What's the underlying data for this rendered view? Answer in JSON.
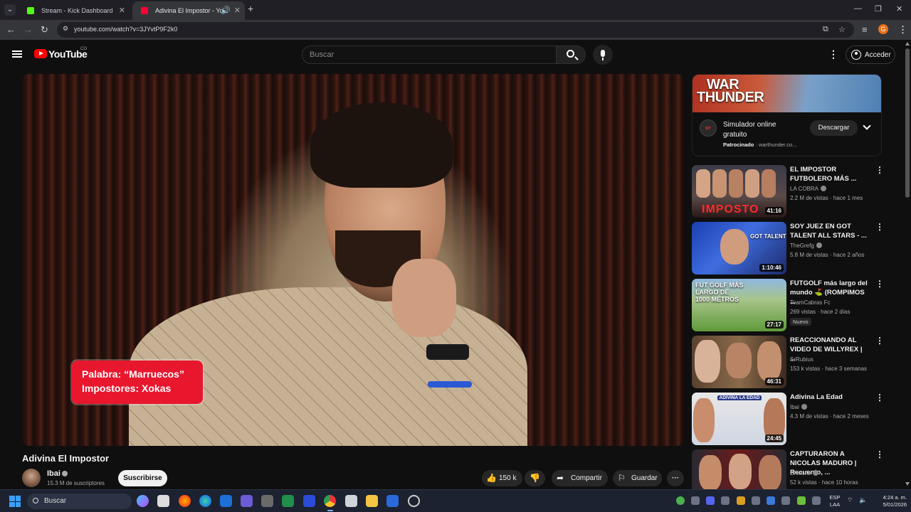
{
  "browser": {
    "tabs": [
      {
        "title": "Stream - Kick Dashboard",
        "favicon_color": "#53fc18"
      },
      {
        "title": "Adivina El Impostor - YouTube",
        "favicon_color": "#ff0033"
      }
    ],
    "new_tab": "+",
    "url": "youtube.com/watch?v=3JYvtP9F2k0",
    "profile_initial": "G"
  },
  "youtube": {
    "logo_text": "YouTube",
    "country_code": "CO",
    "search_placeholder": "Buscar",
    "signin_label": "Acceder"
  },
  "video": {
    "overlay_line1": "Palabra: “Marruecos”",
    "overlay_line2": "Impostores: Xokas",
    "title": "Adivina El Impostor",
    "channel": "Ibai",
    "subscribers": "15.3 M de suscriptores",
    "subscribe_label": "Suscribirse",
    "likes": "150 k",
    "share_label": "Compartir",
    "save_label": "Guardar"
  },
  "ad": {
    "brand": "WAR THUNDER",
    "brand_line1": "WAR",
    "brand_line2": "THUNDER",
    "title": "Simulador online gratuito",
    "sponsored": "Patrocinado",
    "domain": "warthunder.co...",
    "cta": "Descargar"
  },
  "recommended": [
    {
      "title": "EL IMPOSTOR FUTBOLERO MÁS ...",
      "channel": "LA COBRA",
      "verified": true,
      "meta": "2.2 M de vistas · hace 1 mes",
      "duration": "41:16",
      "badge": "",
      "thumb_text": "IMPOSTO"
    },
    {
      "title": "SOY JUEZ EN GOT TALENT ALL STARS - ...",
      "channel": "TheGrefg",
      "verified": true,
      "meta": "5.8 M de vistas · hace 2 años",
      "duration": "1:10:46",
      "badge": "",
      "thumb_text": "GOT TALENT"
    },
    {
      "title": "FUTGOLF más largo del mundo ⛳ (ROMPIMOS ...",
      "channel": "TeamCabras Fc",
      "verified": false,
      "meta": "269 vistas · hace 2 días",
      "duration": "27:17",
      "badge": "Nuevo",
      "thumb_text": "FUT GOLF MÁS LARGO DE 1000 METROS"
    },
    {
      "title": "REACCIONANDO AL VIDEO DE WILLYREX | ...",
      "channel": "SrRubius",
      "verified": false,
      "meta": "153 k vistas · hace 3 semanas",
      "duration": "46:31",
      "badge": "",
      "thumb_text": ""
    },
    {
      "title": "Adivina La Edad",
      "channel": "Ibai",
      "verified": true,
      "meta": "4.3 M de vistas · hace 2 meses",
      "duration": "24:45",
      "badge": "",
      "thumb_text": "ADIVINA LA EDAD"
    },
    {
      "title": "CAPTURARON A NICOLAS MADURO | Recuento, ...",
      "channel": "El Muñe",
      "verified": true,
      "meta": "52 k vistas · hace 10 horas",
      "duration": "",
      "badge": "",
      "thumb_text": ""
    }
  ],
  "taskbar": {
    "search_label": "Buscar",
    "lang_line1": "ESP",
    "lang_line2": "LAA",
    "time": "4:24 a. m.",
    "date": "5/01/2026"
  }
}
